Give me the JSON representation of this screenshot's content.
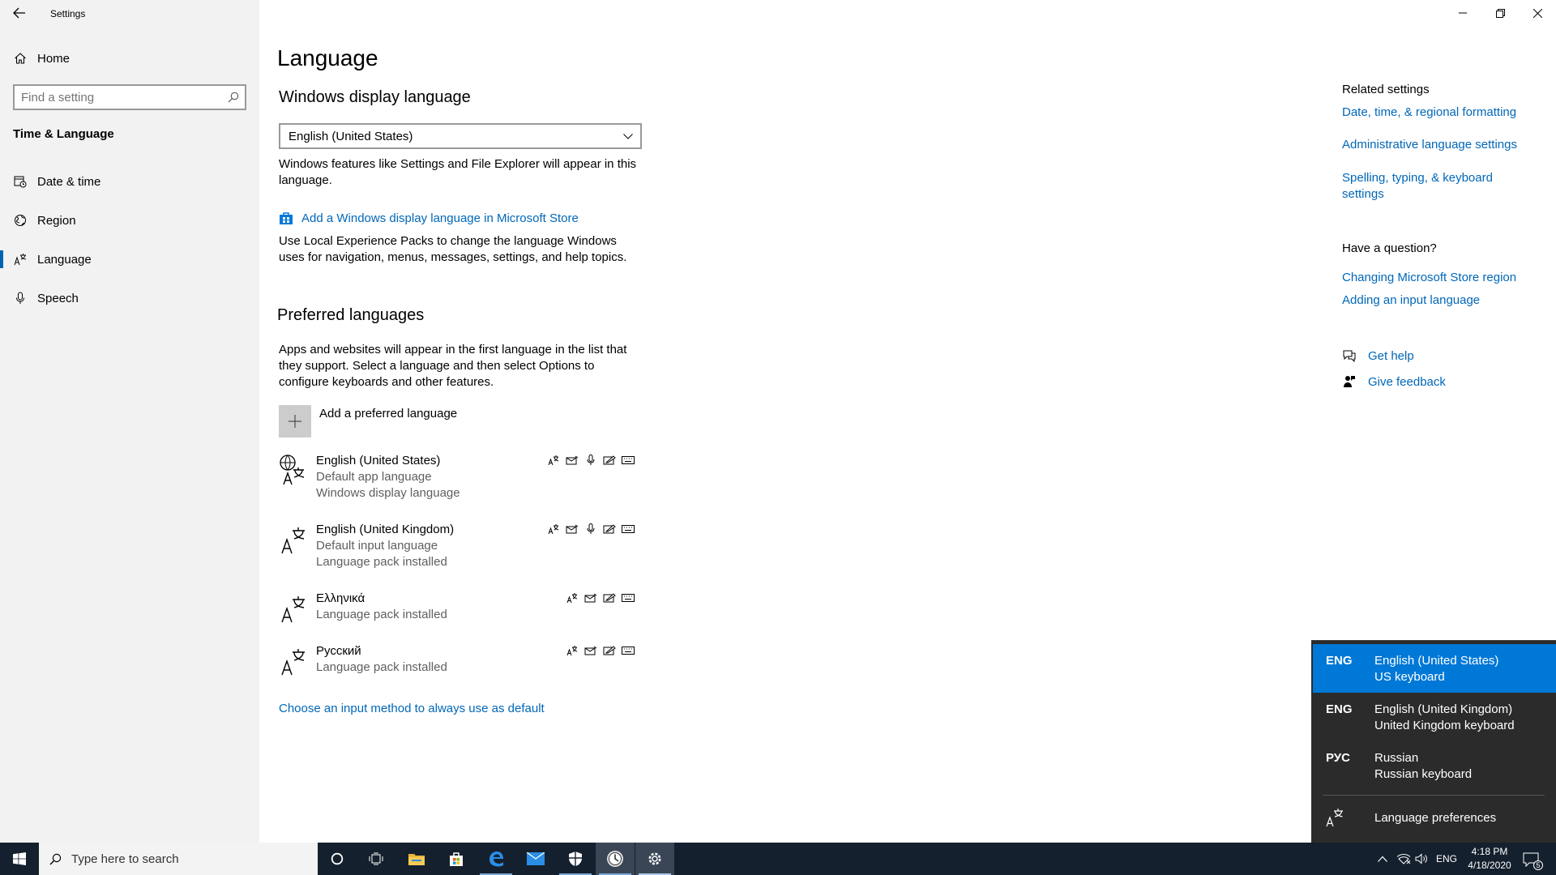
{
  "window": {
    "title": "Settings",
    "back_icon": "back-arrow-icon",
    "controls": [
      "minimize",
      "restore",
      "close"
    ]
  },
  "sidebar": {
    "home_label": "Home",
    "search_placeholder": "Find a setting",
    "section_title": "Time & Language",
    "items": [
      {
        "label": "Date & time",
        "icon": "calendar-clock-icon",
        "active": false
      },
      {
        "label": "Region",
        "icon": "globe-icon",
        "active": false
      },
      {
        "label": "Language",
        "icon": "language-icon",
        "active": true
      },
      {
        "label": "Speech",
        "icon": "microphone-icon",
        "active": false
      }
    ]
  },
  "main": {
    "page_title": "Language",
    "display_language": {
      "heading": "Windows display language",
      "selected": "English (United States)",
      "description": "Windows features like Settings and File Explorer will appear in this language.",
      "store_link": "Add a Windows display language in Microsoft Store",
      "store_description": "Use Local Experience Packs to change the language Windows uses for navigation, menus, messages, settings, and help topics."
    },
    "preferred": {
      "heading": "Preferred languages",
      "description": "Apps and websites will appear in the first language in the list that they support. Select a language and then select Options to configure keyboards and other features.",
      "add_label": "Add a preferred language",
      "languages": [
        {
          "name": "English (United States)",
          "line1": "Default app language",
          "line2": "Windows display language",
          "features": [
            "display",
            "text-to-speech",
            "speech",
            "handwriting",
            "keyboard"
          ]
        },
        {
          "name": "English (United Kingdom)",
          "line1": "Default input language",
          "line2": "Language pack installed",
          "features": [
            "display",
            "text-to-speech",
            "speech",
            "handwriting",
            "keyboard"
          ]
        },
        {
          "name": "Ελληνικά",
          "line1": "Language pack installed",
          "line2": "",
          "features": [
            "display",
            "text-to-speech",
            "handwriting",
            "keyboard"
          ]
        },
        {
          "name": "Русский",
          "line1": "Language pack installed",
          "line2": "",
          "features": [
            "display",
            "text-to-speech",
            "handwriting",
            "keyboard"
          ]
        }
      ],
      "input_method_link": "Choose an input method to always use as default"
    }
  },
  "related": {
    "heading": "Related settings",
    "links": [
      "Date, time, & regional formatting",
      "Administrative language settings",
      "Spelling, typing, & keyboard settings"
    ],
    "question_heading": "Have a question?",
    "question_links": [
      "Changing Microsoft Store region",
      "Adding an input language"
    ],
    "help_label": "Get help",
    "feedback_label": "Give feedback"
  },
  "flyout": {
    "items": [
      {
        "code": "ENG",
        "line1": "English (United States)",
        "line2": "US keyboard",
        "selected": true
      },
      {
        "code": "ENG",
        "line1": "English (United Kingdom)",
        "line2": "United Kingdom keyboard",
        "selected": false
      },
      {
        "code": "РУС",
        "line1": "Russian",
        "line2": "Russian keyboard",
        "selected": false
      }
    ],
    "preferences_label": "Language preferences"
  },
  "taskbar": {
    "search_placeholder": "Type here to search",
    "apps": [
      "cortana-icon",
      "task-view-icon",
      "file-explorer-icon",
      "store-icon",
      "edge-icon",
      "mail-icon",
      "security-icon",
      "clock-app-icon",
      "settings-icon"
    ],
    "input_indicator": "ENG",
    "time": "4:18 PM",
    "date": "4/18/2020",
    "notification_count": "5"
  },
  "colors": {
    "accent": "#0078d7",
    "link": "#0067b8",
    "sidebar_bg": "#f2f2f2",
    "taskbar_bg": "#15202e",
    "flyout_bg": "#2b2b2b"
  }
}
